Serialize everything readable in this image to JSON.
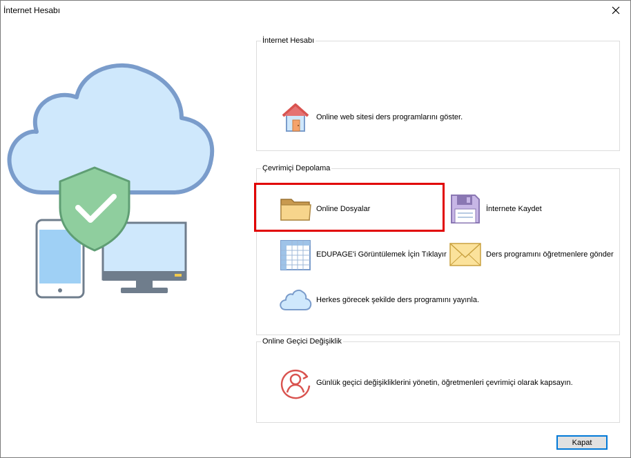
{
  "window": {
    "title": "İnternet Hesabı",
    "close_glyph": "✕"
  },
  "groups": {
    "internet_account": {
      "label": "İnternet Hesabı",
      "items": [
        {
          "label": "Online web sitesi ders programlarını göster.",
          "icon": "house-icon"
        }
      ]
    },
    "online_storage": {
      "label": "Çevrimiçi Depolama",
      "items": [
        {
          "label": "Online Dosyalar",
          "icon": "folder-icon"
        },
        {
          "label": "İnternete Kaydet",
          "icon": "floppy-disk-icon"
        },
        {
          "label": "EDUPAGE'i Görüntülemek İçin Tıklayır",
          "icon": "table-grid-icon"
        },
        {
          "label": "Ders programını öğretmenlere gönder",
          "icon": "envelope-icon"
        },
        {
          "label": "Herkes görecek şekilde ders programını yayınla.",
          "icon": "cloud-icon"
        }
      ]
    },
    "online_substitution": {
      "label": "Online Geçici Değişiklik",
      "items": [
        {
          "label": "Günlük geçici değişikliklerini yönetin, öğretmenleri çevrimiçi olarak kapsayın.",
          "icon": "person-sync-icon"
        }
      ]
    }
  },
  "footer": {
    "close_label": "Kapat"
  },
  "colors": {
    "highlight": "#e10000",
    "cloud_fill": "#cfe8fc",
    "cloud_stroke": "#7a9ccb",
    "shield": "#8fce9e",
    "accent_button": "#0078d7"
  }
}
